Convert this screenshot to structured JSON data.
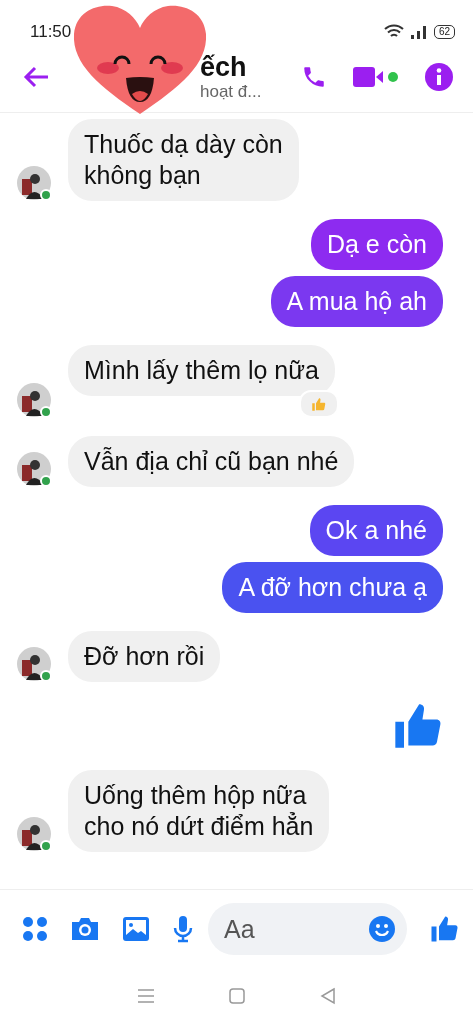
{
  "status_bar": {
    "time": "11:50",
    "battery": "62"
  },
  "header": {
    "name": "ếch",
    "status": "hoạt đ...",
    "video_online": true
  },
  "composer": {
    "placeholder": "Aa"
  },
  "groups": [
    {
      "kind": "incoming",
      "online": true,
      "messages": [
        {
          "kind": "text",
          "text": "Thuốc dạ dày còn\nkhông bạn",
          "reacted": false
        }
      ]
    },
    {
      "kind": "outgoing",
      "messages": [
        {
          "kind": "text",
          "text": "Dạ e còn",
          "color": "#8d2bf0",
          "reacted": false
        },
        {
          "kind": "text",
          "text": "A mua hộ ah",
          "color": "#7b38f0",
          "reacted": false
        }
      ]
    },
    {
      "kind": "incoming",
      "online": true,
      "messages": [
        {
          "kind": "text",
          "text": "Mình lấy thêm lọ nữa",
          "reacted": true
        }
      ]
    },
    {
      "kind": "incoming",
      "online": true,
      "messages": [
        {
          "kind": "text",
          "text": "Vẫn địa chỉ cũ bạn nhé",
          "reacted": false
        }
      ]
    },
    {
      "kind": "outgoing",
      "messages": [
        {
          "kind": "text",
          "text": "Ok a nhé",
          "color": "#5b46f2",
          "reacted": false
        },
        {
          "kind": "text",
          "text": "A đỡ hơn chưa ạ",
          "color": "#4a52f0",
          "reacted": false
        }
      ]
    },
    {
      "kind": "incoming",
      "online": true,
      "messages": [
        {
          "kind": "text",
          "text": "Đỡ hơn rồi",
          "reacted": false
        }
      ]
    },
    {
      "kind": "outgoing",
      "messages": [
        {
          "kind": "like"
        }
      ]
    },
    {
      "kind": "incoming",
      "online": true,
      "messages": [
        {
          "kind": "text",
          "text": "Uống thêm hộp nữa\ncho nó dứt điểm hẳn",
          "reacted": false
        }
      ]
    }
  ]
}
